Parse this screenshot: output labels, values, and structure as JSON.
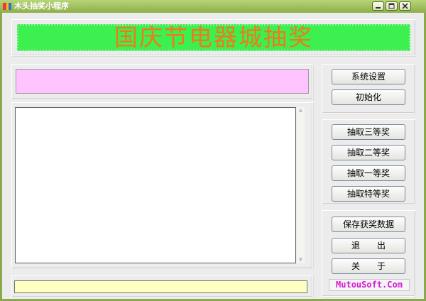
{
  "window": {
    "title": "木头抽奖小程序"
  },
  "banner": {
    "text": "国庆节电器城抽奖"
  },
  "settings": {
    "system_settings": "系统设置",
    "initialize": "初始化"
  },
  "draw": {
    "third_prize": "抽取三等奖",
    "second_prize": "抽取二等奖",
    "first_prize": "抽取一等奖",
    "special_prize": "抽取特等奖"
  },
  "actions": {
    "save_data": "保存获奖数据",
    "exit": "退　　出",
    "about": "关　　于"
  },
  "brand": {
    "text": "MutouSoft.Com"
  },
  "colors": {
    "banner_bg": "#3bf04f",
    "banner_text": "#f07a1a",
    "pink_box": "#ffc4ff",
    "status_box": "#ffffc4",
    "brand_text": "#d41cd4",
    "title_bar": "#8daf4a"
  },
  "icons": {
    "app": "app-icon",
    "minimize": "minimize-icon",
    "maximize": "maximize-icon",
    "close": "close-icon"
  }
}
